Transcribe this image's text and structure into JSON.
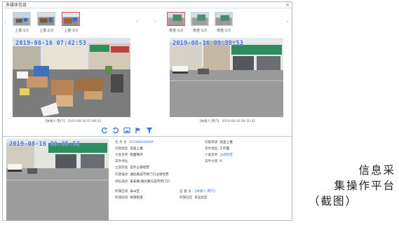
{
  "window": {
    "title": "多媒体信息",
    "close_glyph": "×"
  },
  "thumbnails": {
    "left": [
      {
        "label": "上报-1/3"
      },
      {
        "label": "上报-2/3"
      },
      {
        "label": "上报-3/3"
      }
    ],
    "right": [
      {
        "label": "核查-1/3"
      },
      {
        "label": "核查-1/3"
      },
      {
        "label": "核查-1/3"
      }
    ],
    "prev_glyph": "‹",
    "next_glyph": "›"
  },
  "left_photo": {
    "timestamp": "2019-08-16 07:42:53",
    "caption": "【本报人:用户】 2019-08-16 07:48:53"
  },
  "right_photo": {
    "timestamp": "2019-08-16 09:35:53",
    "caption": "【本报人:用户】 2019-08-16 09:35:41"
  },
  "bottom_photo": {
    "timestamp": "2019-08-16 09:35:53",
    "expand_glyph": "⤢"
  },
  "toolbar": {
    "icons": [
      "rotate-left-icon",
      "rotate-right-icon",
      "image-icon",
      "flag-icon",
      "filter-icon"
    ],
    "accent": "#3a7bd5"
  },
  "info": {
    "task_no_label": "任 务 号",
    "task_no_value": "201908160069",
    "problem_source_label": "问题来源",
    "problem_source_value": "巡查上报",
    "problem_type_label": "问题类型",
    "problem_type_value": "巡查上报",
    "case_class_label": "案件类型",
    "case_class_value": "工作面",
    "major_label": "大类名称",
    "major_value": "街面秩序",
    "minor_label": "小类名称",
    "minor_value": "占道经营",
    "area_label": "案件地址",
    "area_value": "",
    "score_label": "案件分值",
    "score_value": "0",
    "standard_label": "立案标准",
    "standard_value": "店外占道经营",
    "desc_label": "问题描述",
    "desc_value": "通达路菜市场门口占道经营",
    "location_label": "地址描述",
    "location_value": "泰安路/通达路与菜市场门口",
    "district_label": "所属区域",
    "district_value": "泰山区",
    "reporter_label": "监 督 员",
    "reporter_value": "【本报人:用户】",
    "street_label": "所属街道",
    "street_value": "财源街道",
    "community_label": "所属社区",
    "community_value": "东岳社区"
  },
  "side_caption": {
    "line1": "信息采",
    "line2": "集操作平台",
    "line3": "（截图）"
  }
}
